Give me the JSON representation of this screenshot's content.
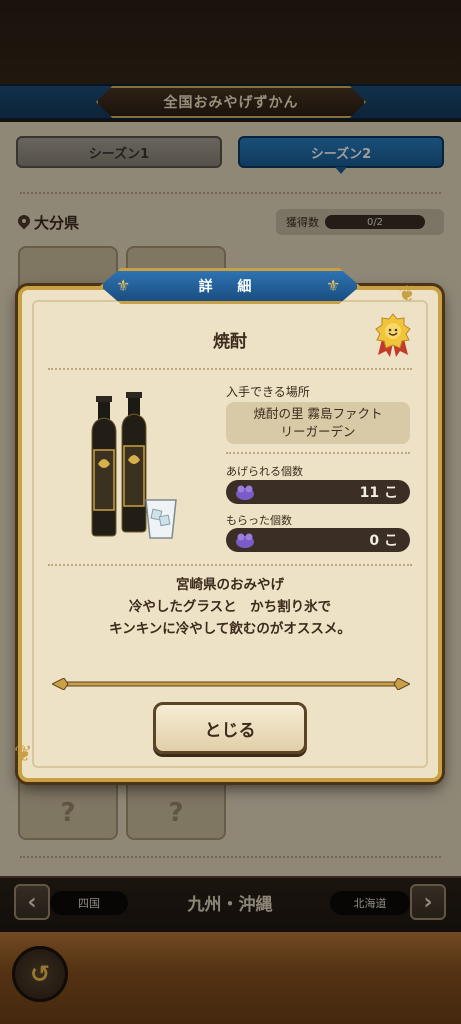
{
  "header": {
    "title": "全国おみやげずかん"
  },
  "seasons": {
    "tab1": "シーズン1",
    "tab2": "シーズン2"
  },
  "prefecture": {
    "name": "大分県",
    "count_label": "獲得数",
    "count_value": "0/2"
  },
  "grid": {
    "placeholder": "?"
  },
  "modal": {
    "tag": "詳 細",
    "item_name": "焼酎",
    "place_label": "入手できる場所",
    "place_value_line1": "焼酎の里 霧島ファクト",
    "place_value_line2": "リーガーデン",
    "give_label": "あげられる個数",
    "give_value": "11 こ",
    "received_label": "もらった個数",
    "received_value": "0 こ",
    "desc_line1": "宮崎県のおみやげ",
    "desc_line2": "冷やしたグラスと　かち割り氷で",
    "desc_line3": "キンキンに冷やして飲むのがオススメ。",
    "close_label": "とじる"
  },
  "nav": {
    "prev": "四国",
    "current": "九州・沖縄",
    "next": "北海道"
  },
  "colors": {
    "accent_blue": "#1b5f97",
    "gold": "#c9a043",
    "parchment": "#eee2c6"
  },
  "icons": [
    "map-pin-icon",
    "gold-medal-icon",
    "gift-icon",
    "chevron-left-icon",
    "chevron-right-icon",
    "back-arrow-icon"
  ]
}
